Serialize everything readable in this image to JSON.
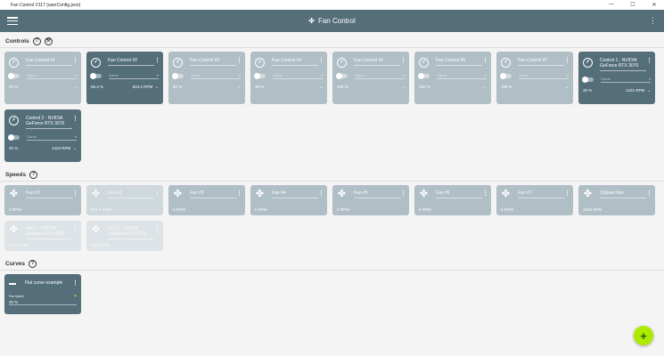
{
  "window": {
    "title": "Fan Control V117 (userConfig.json)",
    "minimize": "—",
    "maximize": "☐",
    "close": "✕"
  },
  "appbar": {
    "title": "Fan Control",
    "fan_glyph": "✤",
    "menu": "⋮"
  },
  "sections": {
    "controls": "Controls",
    "speeds": "Speeds",
    "curves": "Curves"
  },
  "controls": [
    {
      "name": "Fan Control #1",
      "select": "Game",
      "percent": "53 %",
      "rpm": "",
      "active": false
    },
    {
      "name": "Fan Control #2",
      "select": "Game",
      "percent": "55.3 %",
      "rpm": "824.2 RPM",
      "active": true
    },
    {
      "name": "Fan Control #3",
      "select": "Game",
      "percent": "60 %",
      "rpm": "",
      "active": false
    },
    {
      "name": "Fan Control #4",
      "select": "Game",
      "percent": "30 %",
      "rpm": "",
      "active": false
    },
    {
      "name": "Fan Control #5",
      "select": "Game",
      "percent": "100 %",
      "rpm": "",
      "active": false
    },
    {
      "name": "Fan Control #6",
      "select": "Game",
      "percent": "100 %",
      "rpm": "",
      "active": false
    },
    {
      "name": "Fan Control #7",
      "select": "Game",
      "percent": "100 %",
      "rpm": "",
      "active": false
    },
    {
      "name": "Control 1 - NVIDIA GeForce RTX 3070",
      "select": "Game",
      "percent": "30 %",
      "rpm": "1421 RPM",
      "active": true
    },
    {
      "name": "Control 2 - NVIDIA GeForce RTX 3070",
      "select": "Game",
      "percent": "30 %",
      "rpm": "1423 RPM",
      "active": true
    }
  ],
  "speeds": [
    {
      "name": "Fan #1",
      "value": "0 RPM",
      "style": "normal"
    },
    {
      "name": "Fan #2",
      "value": "824.2 RPM",
      "style": "faded"
    },
    {
      "name": "Fan #3",
      "value": "0 RPM",
      "style": "normal"
    },
    {
      "name": "Fan #4",
      "value": "0 RPM",
      "style": "normal"
    },
    {
      "name": "Fan #5",
      "value": "0 RPM",
      "style": "normal"
    },
    {
      "name": "Fan #6",
      "value": "0 RPM",
      "style": "normal"
    },
    {
      "name": "Fan #7",
      "value": "0 RPM",
      "style": "normal"
    },
    {
      "name": "Chipset Fan",
      "value": "2053 RPM",
      "style": "normal"
    },
    {
      "name": "Fan 1 - NVIDIA GeForce RTX 3070",
      "value": "1421 RPM",
      "style": "faded2"
    },
    {
      "name": "Fan 2 - NVIDIA GeForce RTX 3070",
      "value": "1423 RPM",
      "style": "faded2"
    }
  ],
  "curves": [
    {
      "name": "Flat curve example",
      "label": "Fan speed",
      "value": "30 %"
    }
  ],
  "fab": "+"
}
